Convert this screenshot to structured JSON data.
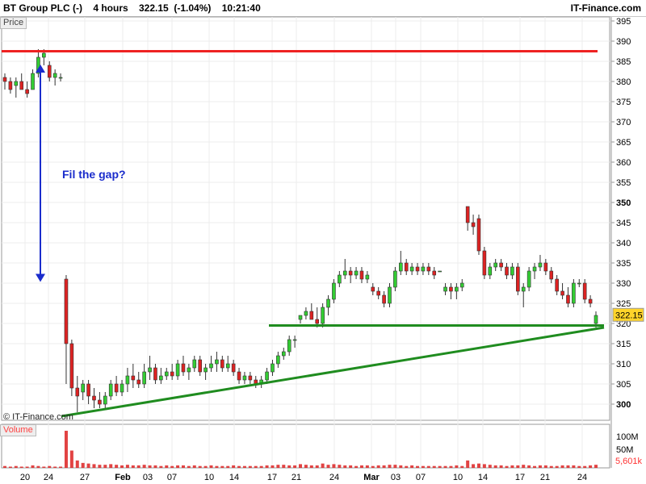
{
  "header": {
    "title": "BT Group PLC (-)    4 hours    322.15  (-1.04%)    10:21:40",
    "brand": "IT-Finance.com"
  },
  "panes": {
    "price_label": "Price",
    "volume_label": "Volume",
    "watermark": "© IT-Finance.com"
  },
  "annotations": {
    "gap_text": "Fil the gap?"
  },
  "colors": {
    "up": "#33cc33",
    "down": "#dd2222",
    "resistance": "#ee2222",
    "trendline": "#1f8c1f",
    "arrow": "#1a2ccc",
    "annotation_text": "#1a2ccc",
    "last_price_bg": "#ffd42a"
  },
  "chart_data": {
    "type": "candlestick",
    "y_axis": {
      "ylim": [
        296,
        396
      ],
      "ticks": [
        300,
        305,
        310,
        315,
        320,
        325,
        330,
        335,
        340,
        345,
        350,
        355,
        360,
        365,
        370,
        375,
        380,
        385,
        390,
        395
      ],
      "bold_ticks": [
        300,
        350
      ]
    },
    "x_tick_labels": [
      "20",
      "24",
      "27",
      "Feb",
      "03",
      "07",
      "10",
      "14",
      "17",
      "21",
      "24",
      "Mar",
      "03",
      "07",
      "10",
      "14",
      "17",
      "21",
      "24"
    ],
    "last_price": {
      "label": "322.15",
      "value": 322.15
    },
    "volume_axis": {
      "ticks": [
        "100M",
        "50M"
      ],
      "last_volume": "5,601k"
    },
    "lines": {
      "resistance": {
        "value": 387.5
      },
      "support": {
        "value": 319.5
      },
      "trend_start": {
        "x_label": "27",
        "value": 297
      },
      "trend_end": {
        "x_label": "24",
        "value": 319
      }
    },
    "candles": [
      {
        "o": 381,
        "h": 382,
        "l": 378,
        "c": 380
      },
      {
        "o": 380,
        "h": 381,
        "l": 377,
        "c": 378
      },
      {
        "o": 379,
        "h": 381,
        "l": 376,
        "c": 380
      },
      {
        "o": 380,
        "h": 382,
        "l": 379,
        "c": 378
      },
      {
        "o": 378,
        "h": 380,
        "l": 376,
        "c": 377
      },
      {
        "o": 378,
        "h": 383,
        "l": 378,
        "c": 382
      },
      {
        "o": 382,
        "h": 388,
        "l": 381,
        "c": 386
      },
      {
        "o": 386,
        "h": 388,
        "l": 384,
        "c": 387
      },
      {
        "o": 384,
        "h": 385,
        "l": 380,
        "c": 381
      },
      {
        "o": 381,
        "h": 383,
        "l": 379,
        "c": 382
      },
      {
        "o": 381,
        "h": 382,
        "l": 380,
        "c": 381
      },
      {
        "o": 331,
        "h": 332,
        "l": 305,
        "c": 315
      },
      {
        "o": 315,
        "h": 316,
        "l": 302,
        "c": 304
      },
      {
        "o": 304,
        "h": 307,
        "l": 298,
        "c": 302
      },
      {
        "o": 303,
        "h": 306,
        "l": 301,
        "c": 305
      },
      {
        "o": 305,
        "h": 306,
        "l": 300,
        "c": 302
      },
      {
        "o": 302,
        "h": 304,
        "l": 299,
        "c": 301
      },
      {
        "o": 301,
        "h": 303,
        "l": 299,
        "c": 300
      },
      {
        "o": 300,
        "h": 303,
        "l": 299,
        "c": 302
      },
      {
        "o": 302,
        "h": 306,
        "l": 301,
        "c": 305
      },
      {
        "o": 305,
        "h": 307,
        "l": 302,
        "c": 303
      },
      {
        "o": 303,
        "h": 306,
        "l": 302,
        "c": 305
      },
      {
        "o": 305,
        "h": 309,
        "l": 303,
        "c": 307
      },
      {
        "o": 307,
        "h": 310,
        "l": 304,
        "c": 306
      },
      {
        "o": 306,
        "h": 308,
        "l": 304,
        "c": 305
      },
      {
        "o": 305,
        "h": 310,
        "l": 304,
        "c": 308
      },
      {
        "o": 308,
        "h": 312,
        "l": 306,
        "c": 309
      },
      {
        "o": 309,
        "h": 310,
        "l": 305,
        "c": 306
      },
      {
        "o": 306,
        "h": 309,
        "l": 305,
        "c": 307
      },
      {
        "o": 307,
        "h": 309,
        "l": 306,
        "c": 308
      },
      {
        "o": 308,
        "h": 310,
        "l": 306,
        "c": 307
      },
      {
        "o": 307,
        "h": 311,
        "l": 306,
        "c": 310
      },
      {
        "o": 310,
        "h": 312,
        "l": 307,
        "c": 308
      },
      {
        "o": 308,
        "h": 310,
        "l": 306,
        "c": 309
      },
      {
        "o": 309,
        "h": 312,
        "l": 308,
        "c": 311
      },
      {
        "o": 311,
        "h": 312,
        "l": 307,
        "c": 308
      },
      {
        "o": 308,
        "h": 310,
        "l": 306,
        "c": 309
      },
      {
        "o": 309,
        "h": 312,
        "l": 308,
        "c": 310
      },
      {
        "o": 310,
        "h": 313,
        "l": 308,
        "c": 311
      },
      {
        "o": 311,
        "h": 312,
        "l": 308,
        "c": 309
      },
      {
        "o": 309,
        "h": 312,
        "l": 308,
        "c": 310
      },
      {
        "o": 310,
        "h": 311,
        "l": 307,
        "c": 308
      },
      {
        "o": 308,
        "h": 309,
        "l": 305,
        "c": 306
      },
      {
        "o": 306,
        "h": 308,
        "l": 305,
        "c": 307
      },
      {
        "o": 307,
        "h": 308,
        "l": 305,
        "c": 306
      },
      {
        "o": 306,
        "h": 307,
        "l": 304,
        "c": 305
      },
      {
        "o": 305,
        "h": 307,
        "l": 304,
        "c": 306
      },
      {
        "o": 306,
        "h": 309,
        "l": 305,
        "c": 308
      },
      {
        "o": 308,
        "h": 311,
        "l": 307,
        "c": 310
      },
      {
        "o": 310,
        "h": 313,
        "l": 309,
        "c": 312
      },
      {
        "o": 312,
        "h": 314,
        "l": 311,
        "c": 313
      },
      {
        "o": 313,
        "h": 317,
        "l": 312,
        "c": 316
      },
      {
        "o": 316,
        "h": 317,
        "l": 314,
        "c": 316
      },
      {
        "o": 321,
        "h": 322,
        "l": 320,
        "c": 322
      },
      {
        "o": 322,
        "h": 324,
        "l": 321,
        "c": 323
      },
      {
        "o": 323,
        "h": 325,
        "l": 321,
        "c": 321
      },
      {
        "o": 321,
        "h": 324,
        "l": 319,
        "c": 320
      },
      {
        "o": 320,
        "h": 325,
        "l": 319,
        "c": 324
      },
      {
        "o": 324,
        "h": 327,
        "l": 322,
        "c": 326
      },
      {
        "o": 326,
        "h": 331,
        "l": 325,
        "c": 330
      },
      {
        "o": 330,
        "h": 333,
        "l": 329,
        "c": 332
      },
      {
        "o": 332,
        "h": 336,
        "l": 331,
        "c": 333
      },
      {
        "o": 333,
        "h": 334,
        "l": 330,
        "c": 332
      },
      {
        "o": 332,
        "h": 334,
        "l": 331,
        "c": 333
      },
      {
        "o": 333,
        "h": 334,
        "l": 330,
        "c": 331
      },
      {
        "o": 331,
        "h": 333,
        "l": 330,
        "c": 332
      },
      {
        "o": 329,
        "h": 330,
        "l": 327,
        "c": 328
      },
      {
        "o": 328,
        "h": 329,
        "l": 326,
        "c": 327
      },
      {
        "o": 327,
        "h": 328,
        "l": 324,
        "c": 325
      },
      {
        "o": 325,
        "h": 330,
        "l": 324,
        "c": 329
      },
      {
        "o": 329,
        "h": 334,
        "l": 328,
        "c": 333
      },
      {
        "o": 333,
        "h": 338,
        "l": 332,
        "c": 335
      },
      {
        "o": 335,
        "h": 336,
        "l": 332,
        "c": 333
      },
      {
        "o": 333,
        "h": 335,
        "l": 332,
        "c": 334
      },
      {
        "o": 334,
        "h": 335,
        "l": 332,
        "c": 333
      },
      {
        "o": 333,
        "h": 335,
        "l": 332,
        "c": 334
      },
      {
        "o": 334,
        "h": 335,
        "l": 332,
        "c": 333
      },
      {
        "o": 333,
        "h": 334,
        "l": 331,
        "c": 332
      },
      {
        "o": 333,
        "h": 333,
        "l": 333,
        "c": 333
      },
      {
        "o": 328,
        "h": 330,
        "l": 327,
        "c": 329
      },
      {
        "o": 329,
        "h": 330,
        "l": 326,
        "c": 328
      },
      {
        "o": 328,
        "h": 330,
        "l": 326,
        "c": 329
      },
      {
        "o": 329,
        "h": 331,
        "l": 328,
        "c": 330
      },
      {
        "o": 349,
        "h": 349,
        "l": 343,
        "c": 345
      },
      {
        "o": 345,
        "h": 347,
        "l": 342,
        "c": 344
      },
      {
        "o": 346,
        "h": 347,
        "l": 337,
        "c": 338
      },
      {
        "o": 338,
        "h": 339,
        "l": 331,
        "c": 332
      },
      {
        "o": 332,
        "h": 335,
        "l": 331,
        "c": 334
      },
      {
        "o": 334,
        "h": 336,
        "l": 333,
        "c": 335
      },
      {
        "o": 335,
        "h": 336,
        "l": 333,
        "c": 334
      },
      {
        "o": 334,
        "h": 335,
        "l": 331,
        "c": 332
      },
      {
        "o": 332,
        "h": 335,
        "l": 331,
        "c": 334
      },
      {
        "o": 334,
        "h": 335,
        "l": 327,
        "c": 328
      },
      {
        "o": 328,
        "h": 330,
        "l": 324,
        "c": 329
      },
      {
        "o": 329,
        "h": 334,
        "l": 328,
        "c": 333
      },
      {
        "o": 333,
        "h": 335,
        "l": 331,
        "c": 334
      },
      {
        "o": 334,
        "h": 337,
        "l": 333,
        "c": 335
      },
      {
        "o": 335,
        "h": 336,
        "l": 332,
        "c": 333
      },
      {
        "o": 333,
        "h": 334,
        "l": 330,
        "c": 331
      },
      {
        "o": 331,
        "h": 332,
        "l": 327,
        "c": 328
      },
      {
        "o": 328,
        "h": 330,
        "l": 326,
        "c": 327
      },
      {
        "o": 327,
        "h": 329,
        "l": 324,
        "c": 325
      },
      {
        "o": 325,
        "h": 331,
        "l": 324,
        "c": 330
      },
      {
        "o": 330,
        "h": 331,
        "l": 329,
        "c": 330
      },
      {
        "o": 330,
        "h": 331,
        "l": 325,
        "c": 326
      },
      {
        "o": 326,
        "h": 327,
        "l": 324,
        "c": 325
      },
      {
        "o": 320,
        "h": 323,
        "l": 319,
        "c": 322
      }
    ],
    "volumes": [
      3,
      2,
      3,
      2,
      2,
      4,
      3,
      2,
      3,
      2,
      2,
      60,
      28,
      12,
      8,
      7,
      6,
      5,
      5,
      6,
      5,
      4,
      5,
      4,
      4,
      5,
      4,
      4,
      3,
      4,
      3,
      4,
      4,
      3,
      4,
      3,
      3,
      4,
      3,
      3,
      3,
      4,
      3,
      3,
      3,
      3,
      3,
      4,
      4,
      5,
      5,
      4,
      4,
      6,
      5,
      4,
      4,
      7,
      5,
      6,
      5,
      4,
      4,
      3,
      4,
      4,
      3,
      4,
      4,
      5,
      5,
      4,
      3,
      4,
      3,
      3,
      3,
      3,
      3,
      3,
      3,
      4,
      3,
      12,
      6,
      7,
      6,
      5,
      4,
      4,
      3,
      4,
      4,
      5,
      4,
      3,
      4,
      4,
      3,
      3,
      4,
      4,
      4,
      3,
      3,
      4,
      5
    ]
  }
}
